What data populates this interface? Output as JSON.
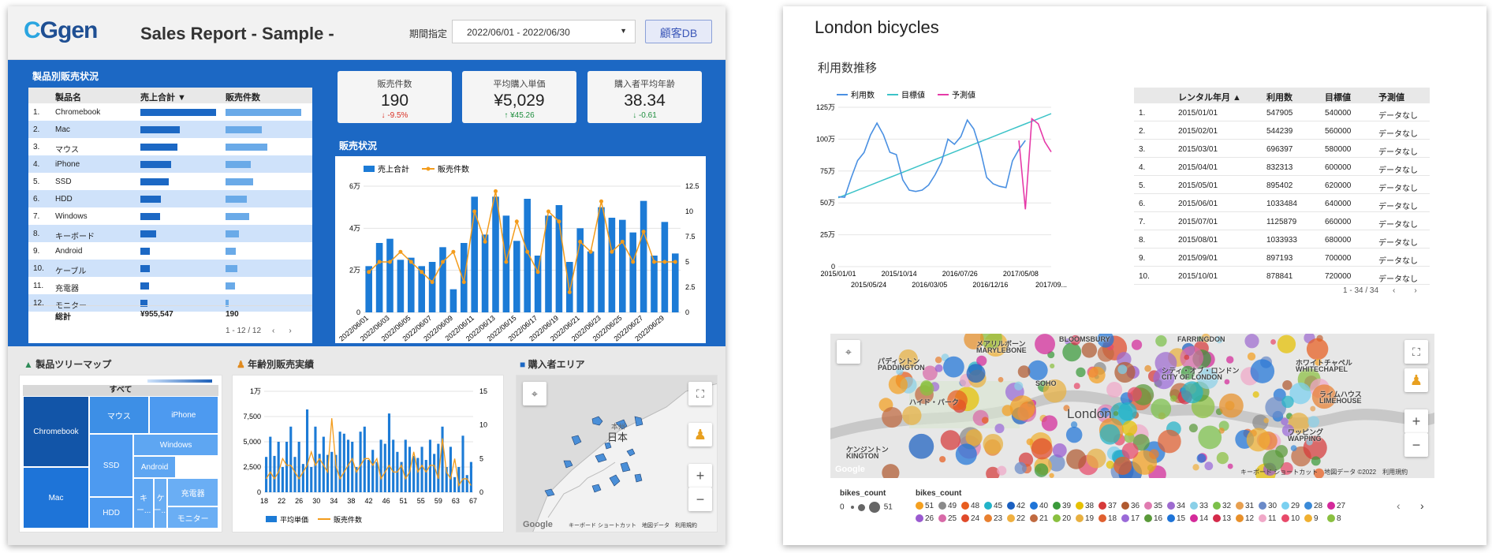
{
  "left": {
    "logo": {
      "part1": "C",
      "part2": "Ggen"
    },
    "title": "Sales Report - Sample -",
    "period_label": "期間指定",
    "date_range": "2022/06/01 - 2022/06/30",
    "customer_db_button": "顧客DB",
    "product_sales": {
      "title": "製品別販売状況",
      "headers": [
        "製品名",
        "売上合計 ▼",
        "販売件数"
      ],
      "rows": [
        {
          "n": "1.",
          "name": "Chromebook",
          "sales": 1.0,
          "count": 1.0
        },
        {
          "n": "2.",
          "name": "Mac",
          "sales": 0.52,
          "count": 0.48
        },
        {
          "n": "3.",
          "name": "マウス",
          "sales": 0.49,
          "count": 0.55
        },
        {
          "n": "4.",
          "name": "iPhone",
          "sales": 0.41,
          "count": 0.33
        },
        {
          "n": "5.",
          "name": "SSD",
          "sales": 0.37,
          "count": 0.36
        },
        {
          "n": "6.",
          "name": "HDD",
          "sales": 0.27,
          "count": 0.28
        },
        {
          "n": "7.",
          "name": "Windows",
          "sales": 0.26,
          "count": 0.31
        },
        {
          "n": "8.",
          "name": "キーボード",
          "sales": 0.21,
          "count": 0.18
        },
        {
          "n": "9.",
          "name": "Android",
          "sales": 0.13,
          "count": 0.14
        },
        {
          "n": "10.",
          "name": "ケーブル",
          "sales": 0.13,
          "count": 0.16
        },
        {
          "n": "11.",
          "name": "充電器",
          "sales": 0.11,
          "count": 0.12
        },
        {
          "n": "12.",
          "name": "モニター",
          "sales": 0.09,
          "count": 0.04
        }
      ],
      "total_label": "総計",
      "total_sales": "¥955,547",
      "total_count": "190",
      "pagination": "1 - 12 / 12"
    },
    "kpis": [
      {
        "label": "販売件数",
        "value": "190",
        "delta": "↓ -9.5%",
        "color": "#d93025"
      },
      {
        "label": "平均購入単価",
        "value": "¥5,029",
        "delta": "↑ ¥45.26",
        "color": "#1e8e3e"
      },
      {
        "label": "購入者平均年齢",
        "value": "38.34",
        "delta": "↓ -0.61",
        "color": "#1e8e3e"
      }
    ],
    "sales_status": {
      "title": "販売状況",
      "legend_bar": "売上合計",
      "legend_line": "販売件数"
    },
    "treemap": {
      "title": "製品ツリーマップ",
      "root": "すべて"
    },
    "age_sales": {
      "title": "年齢別販売実績",
      "legend_bar": "平均単価",
      "legend_line": "販売件数"
    },
    "area": {
      "title": "購入者エリア",
      "map_label": "日本",
      "region": "本州",
      "google": "Google",
      "footer": "キーボード ショートカット　地図データ　利用規約"
    }
  },
  "right": {
    "title": "London bicycles",
    "subtitle": "利用数推移",
    "table": {
      "headers": [
        "レンタル年月 ▲",
        "利用数",
        "目標値",
        "予測値"
      ],
      "rows": [
        [
          "1.",
          "2015/01/01",
          "547905",
          "540000",
          "データなし"
        ],
        [
          "2.",
          "2015/02/01",
          "544239",
          "560000",
          "データなし"
        ],
        [
          "3.",
          "2015/03/01",
          "696397",
          "580000",
          "データなし"
        ],
        [
          "4.",
          "2015/04/01",
          "832313",
          "600000",
          "データなし"
        ],
        [
          "5.",
          "2015/05/01",
          "895402",
          "620000",
          "データなし"
        ],
        [
          "6.",
          "2015/06/01",
          "1033484",
          "640000",
          "データなし"
        ],
        [
          "7.",
          "2015/07/01",
          "1125879",
          "660000",
          "データなし"
        ],
        [
          "8.",
          "2015/08/01",
          "1033933",
          "680000",
          "データなし"
        ],
        [
          "9.",
          "2015/09/01",
          "897193",
          "700000",
          "データなし"
        ],
        [
          "10.",
          "2015/10/01",
          "878841",
          "720000",
          "データなし"
        ]
      ],
      "pagination": "1 - 34 / 34"
    },
    "map": {
      "labels": [
        "BLOOMSBURY",
        "FARRINGDON",
        "メアリルボーン",
        "MARYLEBONE",
        "パディントン",
        "PADDINGTON",
        "ホワイトチャペル",
        "WHITECHAPEL",
        "シティ・オブ・ロンドン",
        "CITY OF LONDON",
        "London",
        "ハイド・パーク",
        "ライムハウス",
        "LIMEHOUSE",
        "ワッピング",
        "WAPPING",
        "ケンジントン",
        "KINGTON",
        "SOHO"
      ],
      "footer": "キーボード ショートカット　地図データ ©2022　利用規約",
      "google": "Google"
    },
    "bikes_legend": {
      "size_title": "bikes_count",
      "size_min": "0",
      "size_max": "51",
      "color_title": "bikes_count",
      "items": [
        [
          "51",
          "#f4a020"
        ],
        [
          "49",
          "#8a8a8a"
        ],
        [
          "48",
          "#e85d1f"
        ],
        [
          "45",
          "#22b3c8"
        ],
        [
          "42",
          "#1a5fc0"
        ],
        [
          "40",
          "#1e74d8"
        ],
        [
          "39",
          "#3a9a3a"
        ],
        [
          "38",
          "#e6c000"
        ],
        [
          "37",
          "#d63a3a"
        ],
        [
          "36",
          "#b05a30"
        ],
        [
          "35",
          "#e07bb0"
        ],
        [
          "34",
          "#9e6bd0"
        ],
        [
          "33",
          "#8ad0e8"
        ],
        [
          "32",
          "#7cc04a"
        ],
        [
          "31",
          "#e8a050"
        ],
        [
          "30",
          "#6a8ac8"
        ],
        [
          "29",
          "#7ad0f0"
        ],
        [
          "28",
          "#3a8ad8"
        ],
        [
          "27",
          "#d42a9a"
        ],
        [
          "26",
          "#9a5ad0"
        ],
        [
          "25",
          "#d86aa8"
        ],
        [
          "24",
          "#e04a2a"
        ],
        [
          "23",
          "#e88030"
        ],
        [
          "22",
          "#f0b040"
        ],
        [
          "21",
          "#c06a40"
        ],
        [
          "20",
          "#8ac040"
        ],
        [
          "19",
          "#e8b040"
        ],
        [
          "18",
          "#e06030"
        ],
        [
          "17",
          "#9a6ad8"
        ],
        [
          "16",
          "#5a9a3a"
        ],
        [
          "15",
          "#1e74d8"
        ],
        [
          "14",
          "#d42a9a"
        ],
        [
          "13",
          "#d42a4a"
        ],
        [
          "12",
          "#e8902a"
        ],
        [
          "11",
          "#f0a8c8"
        ],
        [
          "10",
          "#e84a6a"
        ],
        [
          "9",
          "#f0b030"
        ],
        [
          "8",
          "#8ac040"
        ]
      ]
    }
  },
  "chart_data": [
    {
      "type": "bar",
      "title": "販売状況",
      "series": [
        {
          "name": "売上合計",
          "values": [
            2.2,
            3.3,
            3.5,
            2.5,
            2.6,
            2.2,
            2.4,
            3.1,
            1.1,
            3.3,
            5.5,
            3.7,
            5.5,
            4.6,
            3.4,
            5.4,
            2.7,
            4.6,
            5.1,
            2.4,
            4.0,
            2.9,
            5.0,
            4.5,
            4.4,
            3.8,
            5.3,
            2.7,
            4.3,
            2.8
          ]
        },
        {
          "name": "販売件数",
          "values": [
            4,
            5,
            5,
            6,
            5,
            4,
            3,
            5,
            6,
            3,
            10,
            7,
            12,
            5,
            9,
            6,
            4,
            10,
            9,
            2,
            7,
            6,
            11,
            6,
            7,
            5,
            8,
            5,
            5,
            5
          ]
        }
      ],
      "categories": [
        "2022/06/01",
        "2022/06/02",
        "2022/06/03",
        "2022/06/04",
        "2022/06/05",
        "2022/06/06",
        "2022/06/07",
        "2022/06/08",
        "2022/06/09",
        "2022/06/10",
        "2022/06/11",
        "2022/06/12",
        "2022/06/13",
        "2022/06/14",
        "2022/06/15",
        "2022/06/16",
        "2022/06/17",
        "2022/06/18",
        "2022/06/19",
        "2022/06/20",
        "2022/06/21",
        "2022/06/22",
        "2022/06/23",
        "2022/06/24",
        "2022/06/25",
        "2022/06/26",
        "2022/06/27",
        "2022/06/28",
        "2022/06/29",
        "2022/06/30"
      ],
      "xtick_labels": [
        "2022/06/01",
        "2022/06/03",
        "2022/06/05",
        "2022/06/07",
        "2022/06/09",
        "2022/06/11",
        "2022/06/13",
        "2022/06/15",
        "2022/06/17",
        "2022/06/19",
        "2022/06/21",
        "2022/06/23",
        "2022/06/25",
        "2022/06/27",
        "2022/06/29"
      ],
      "y_left_ticks": [
        "0",
        "2万",
        "4万",
        "6万"
      ],
      "y_left_max": 6,
      "y_right_ticks": [
        "0",
        "2.5",
        "5",
        "7.5",
        "10",
        "12.5"
      ],
      "y_right_max": 12.5
    },
    {
      "type": "treemap",
      "items": [
        {
          "name": "Chromebook",
          "value": 35
        },
        {
          "name": "Mac",
          "value": 17
        },
        {
          "name": "マウス",
          "value": 10
        },
        {
          "name": "iPhone",
          "value": 9
        },
        {
          "name": "SSD",
          "value": 8
        },
        {
          "name": "HDD",
          "value": 6
        },
        {
          "name": "Windows",
          "value": 6
        },
        {
          "name": "Android",
          "value": 3
        },
        {
          "name": "キー...",
          "value": 3
        },
        {
          "name": "ケー...",
          "value": 2
        },
        {
          "name": "充電器",
          "value": 2
        },
        {
          "name": "モニター",
          "value": 2
        }
      ]
    },
    {
      "type": "bar",
      "title": "年齢別販売実績",
      "series": [
        {
          "name": "平均単価",
          "values": [
            3500,
            5500,
            3600,
            5000,
            2500,
            5000,
            6500,
            3500,
            5000,
            2800,
            8200,
            2500,
            6500,
            3800,
            5500,
            3700,
            4000,
            3700,
            6000,
            5800,
            5200,
            5000,
            2500,
            6000,
            6500,
            3200,
            4200,
            3000,
            5200,
            4800,
            7800,
            5200,
            4000,
            3000,
            5200,
            4500,
            3600,
            3400,
            4500,
            3200,
            5200,
            3800,
            4800,
            6500,
            2500,
            4500,
            1500,
            2500,
            5600,
            1700,
            3000
          ]
        },
        {
          "name": "販売件数",
          "values": [
            2,
            3,
            2,
            3,
            5,
            4,
            4,
            3,
            2,
            3,
            4,
            6,
            4,
            5,
            4,
            3,
            11,
            4,
            2,
            3,
            4,
            5,
            3,
            4,
            5,
            5,
            4,
            5,
            2,
            3,
            4,
            3,
            3,
            4,
            2,
            3,
            6,
            3,
            4,
            3,
            4,
            4,
            2,
            8,
            3,
            2,
            5,
            1,
            2,
            2,
            1
          ]
        }
      ],
      "xtick_labels": [
        "18",
        "22",
        "26",
        "30",
        "34",
        "38",
        "42",
        "46",
        "51",
        "55",
        "59",
        "63",
        "67"
      ],
      "y_left_ticks": [
        "0",
        "2,500",
        "5,000",
        "7,500",
        "1万"
      ],
      "y_left_max": 10000,
      "y_right_ticks": [
        "0",
        "5",
        "10",
        "15"
      ],
      "y_right_max": 15
    },
    {
      "type": "line",
      "title": "利用数推移",
      "series": [
        {
          "name": "利用数",
          "values": [
            547905,
            544239,
            696397,
            832313,
            895402,
            1033484,
            1125879,
            1033933,
            897193,
            878841,
            680000,
            600000,
            590000,
            600000,
            640000,
            720000,
            820000,
            1000000,
            960000,
            1020000,
            1150000,
            1080000,
            920000,
            700000,
            650000,
            630000,
            620000,
            830000,
            920000,
            990000
          ]
        },
        {
          "name": "目標値",
          "values": [
            540000,
            560000,
            580000,
            600000,
            620000,
            640000,
            660000,
            680000,
            700000,
            720000,
            740000,
            760000,
            780000,
            800000,
            820000,
            840000,
            860000,
            880000,
            900000,
            920000,
            940000,
            960000,
            980000,
            1000000,
            1020000,
            1040000,
            1060000,
            1080000,
            1100000,
            1120000,
            1140000,
            1160000,
            1180000,
            1200000
          ]
        },
        {
          "name": "予測値",
          "values": [
            990000,
            450000,
            1160000,
            1120000,
            980000,
            900000
          ]
        }
      ],
      "xtick_labels": [
        "2015/01/01",
        "2015/05/24",
        "2015/10/14",
        "2016/03/05",
        "2016/07/26",
        "2016/12/16",
        "2017/05/08",
        "2017/09..."
      ],
      "y_ticks": [
        "0",
        "25万",
        "50万",
        "75万",
        "100万",
        "125万"
      ],
      "y_max": 1250000
    }
  ]
}
